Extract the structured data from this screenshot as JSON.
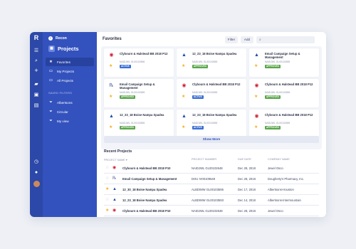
{
  "rail": {
    "logo": "R",
    "icons": [
      "menu-icon",
      "search-icon",
      "add-icon",
      "chat-icon",
      "inbox-icon",
      "calendar-icon",
      "history-icon",
      "notifications-icon",
      "user-avatar"
    ]
  },
  "sidebar": {
    "back_label": "Recon",
    "section_title": "Projects",
    "items": [
      {
        "label": "Favorites",
        "icon": "star-icon"
      },
      {
        "label": "My Projects",
        "icon": "folder-icon"
      },
      {
        "label": "All Projects",
        "icon": "folder-icon"
      }
    ],
    "saved_filters_title": "SAVED FILTERS",
    "filters": [
      {
        "label": "Albertsons",
        "icon": "filter-icon"
      },
      {
        "label": "Circular",
        "icon": "filter-icon"
      },
      {
        "label": "My view",
        "icon": "filter-icon"
      }
    ]
  },
  "favorites": {
    "title": "Favorites",
    "filter_label": "Filter",
    "add_label": "Add",
    "search_placeholder": "",
    "show_more_label": "Show More",
    "cards": [
      {
        "title": "Clybourn & Halstead BB 2018 P12",
        "number": "NAIDJWL GL00102656",
        "badge": "ACTIVE",
        "logo": "jewel-logo"
      },
      {
        "title": "12_23_18 Boise Nampa Spadea",
        "number": "NAIDJWL GL00102655",
        "badge": "APPROVED",
        "logo": "albertsons-logo"
      },
      {
        "title": "Email Campaign Setup & Management",
        "number": "NAIDJWL GL00102655",
        "badge": "APPROVED",
        "logo": "albertsons-logo"
      },
      {
        "title": "Email Campaign Setup & Management",
        "number": "NAIDJWL GL00102655",
        "badge": "APPROVED",
        "logo": "dougherty-logo"
      },
      {
        "title": "Clybourn & Halstead BB 2018 P12",
        "number": "NAIDJWL GL00102655",
        "badge": "ACTIVE",
        "logo": "jewel-logo"
      },
      {
        "title": "Clybourn & Halstead BB 2018 P12",
        "number": "NAIDJWL GL00102655",
        "badge": "APPROVED",
        "logo": "jewel-logo"
      },
      {
        "title": "12_23_18 Boise Nampa Spadea",
        "number": "NAIDJWL GL00102655",
        "badge": "APPROVED",
        "logo": "albertsons-logo"
      },
      {
        "title": "12_23_18 Boise Nampa Spadea",
        "number": "NAIDJWL GL00102655",
        "badge": "ACTIVE",
        "logo": "albertsons-logo"
      },
      {
        "title": "Clybourn & Halstead BB 2018 P12",
        "number": "NAIDJWL GL00102655",
        "badge": "APPROVED",
        "logo": "jewel-logo"
      }
    ]
  },
  "recent": {
    "title": "Recent Projects",
    "headers": [
      "PROJECT NAME",
      "PROJECT NUMBER",
      "DUE DATE",
      "COMPANY NAME"
    ],
    "rows": [
      {
        "starred": false,
        "name": "Clybourn & Halstead BB 2018 P10",
        "number": "NAIDJWL GL00102648",
        "due": "Dec 28, 2018",
        "company": "Jewel Osco",
        "logo": "jewel-logo"
      },
      {
        "starred": false,
        "name": "Email Campaign Setup & Management",
        "number": "DOU IV00109549",
        "due": "Dec 28, 2018",
        "company": "Dougherty's Pharmacy, Inc.",
        "logo": "dougherty-logo"
      },
      {
        "starred": true,
        "name": "12_30_18 Boise Nampa Spadea",
        "number": "ALBDIMW GL00103595",
        "due": "Dec 17, 2018",
        "company": "Albertsons-Houston",
        "logo": "albertsons-logo"
      },
      {
        "starred": false,
        "name": "12_23_18 Boise Nampa Spadea",
        "number": "ALBDIMW GL00103593",
        "due": "Dec 14, 2018",
        "company": "Albertsons-Intermountain",
        "logo": "albertsons-logo"
      },
      {
        "starred": true,
        "name": "Clybourn & Halstead BB 2018 P10",
        "number": "NAIDJWL GL00102648",
        "due": "Dec 28, 2018",
        "company": "Jewel Osco",
        "logo": "jewel-logo"
      }
    ]
  },
  "colors": {
    "rail": "#2c48a8",
    "sidebar": "#3352bd",
    "active_badge": "#3b6fd4",
    "approved_badge": "#5aa64b",
    "star": "#f5b120"
  }
}
